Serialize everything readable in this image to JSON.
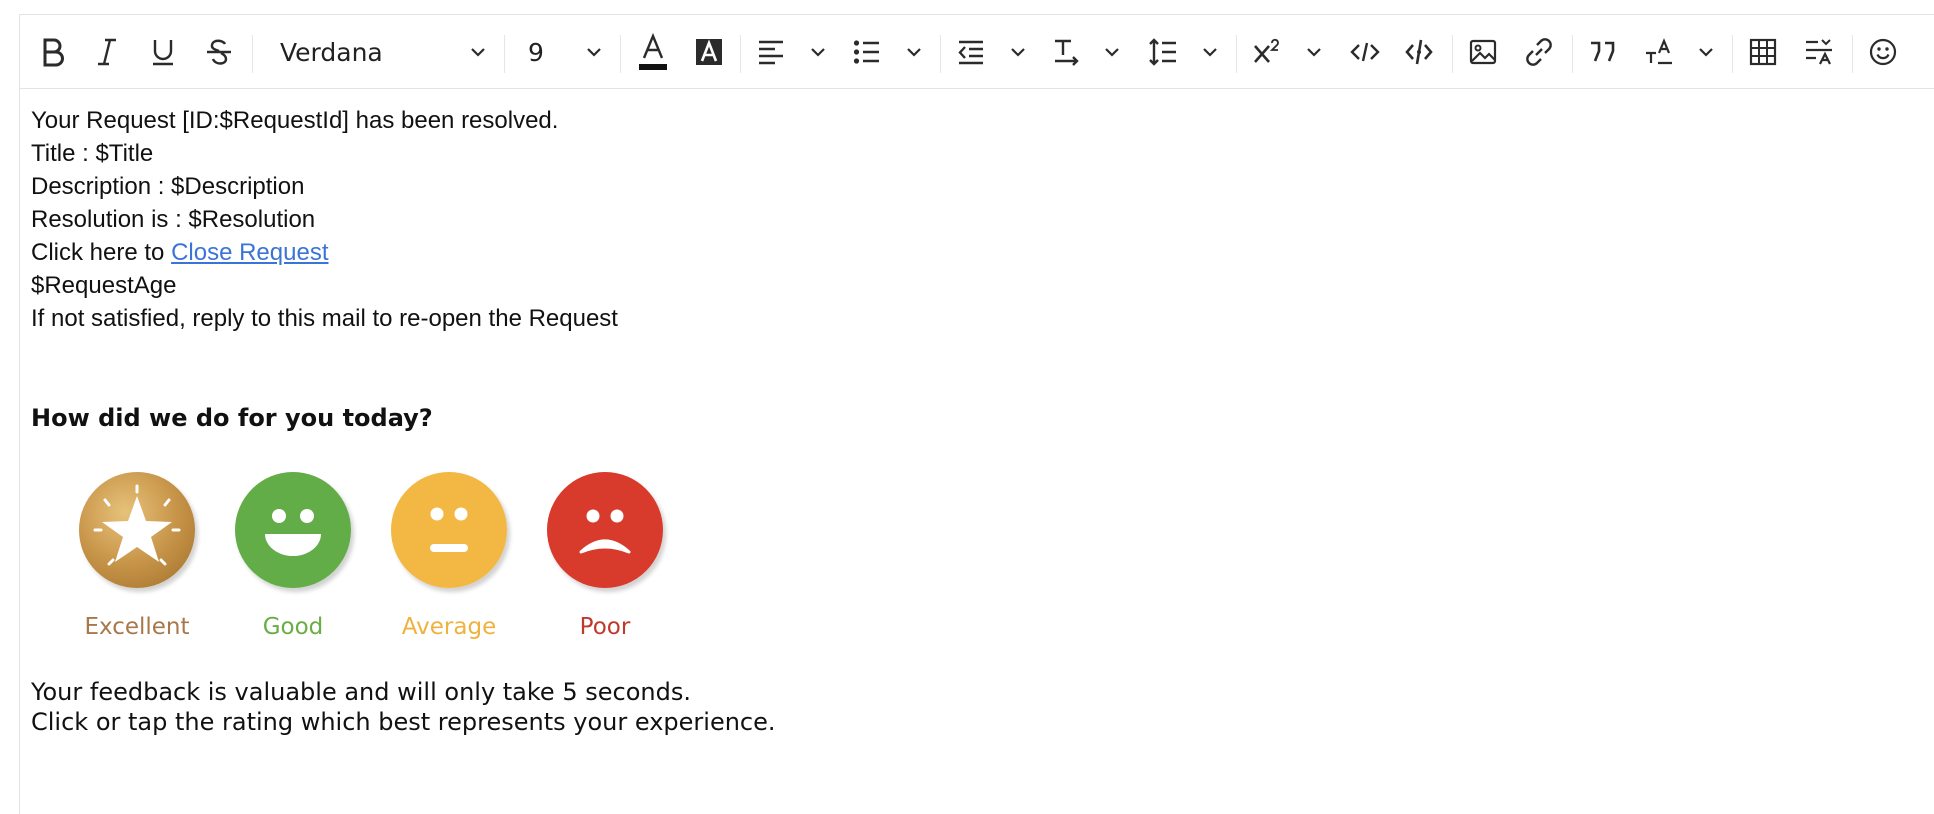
{
  "toolbar": {
    "font_family": "Verdana",
    "font_size": "9"
  },
  "body": {
    "lines": [
      "Your Request [ID:$RequestId] has been resolved.",
      "Title : $Title",
      "Description : $Description",
      "Resolution is : $Resolution",
      "Click here to ",
      "$RequestAge",
      "If not satisfied, reply to this mail to re-open the Request"
    ],
    "close_link": "Close Request",
    "question": "How did we do for you today?"
  },
  "ratings": [
    {
      "label": "Excellent",
      "color": "#c8964a",
      "label_color": "#a8784a"
    },
    {
      "label": "Good",
      "color": "#62ad47",
      "label_color": "#6aad45"
    },
    {
      "label": "Average",
      "color": "#f2b843",
      "label_color": "#efb23e"
    },
    {
      "label": "Poor",
      "color": "#d83a2c",
      "label_color": "#c0392b"
    }
  ],
  "footer": {
    "line1": "Your feedback is valuable and will only take 5 seconds.",
    "line2": "Click or tap the rating which best represents your experience."
  }
}
